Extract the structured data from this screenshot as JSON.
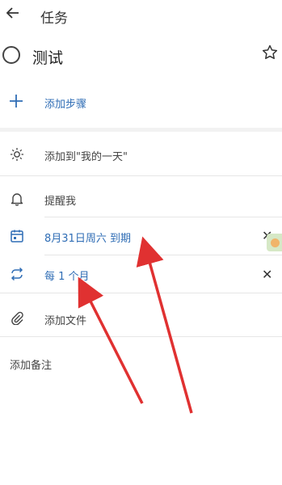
{
  "header": {
    "title": "任务"
  },
  "task": {
    "title": "测试"
  },
  "steps": {
    "add_label": "添加步骤"
  },
  "list": {
    "my_day": "添加到\"我的一天\"",
    "remind": "提醒我",
    "due": "8月31日周六 到期",
    "repeat": "每 1 个月",
    "file": "添加文件"
  },
  "note": {
    "placeholder": "添加备注"
  },
  "colors": {
    "accent": "#2f6db5",
    "arrow": "#e03131"
  }
}
